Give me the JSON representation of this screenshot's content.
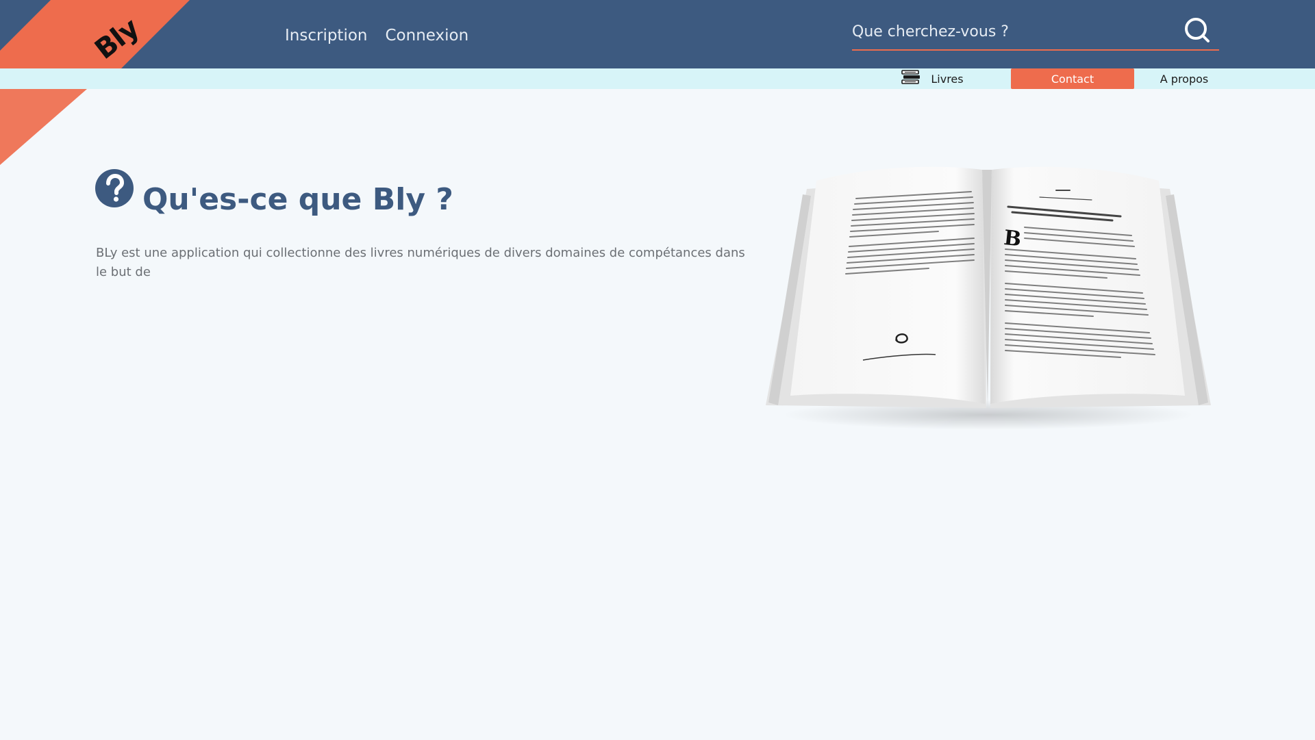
{
  "header": {
    "logo_text": "Bly",
    "nav": {
      "signup_label": "Inscription",
      "login_label": "Connexion"
    },
    "search": {
      "placeholder": "Que cherchez-vous ?",
      "value": "",
      "icon": "search-icon"
    }
  },
  "subnav": {
    "books": {
      "label": "Livres",
      "icon": "books-icon"
    },
    "contact": {
      "label": "Contact"
    },
    "about": {
      "label": "A propos"
    }
  },
  "main": {
    "title_icon": "question-circle-icon",
    "title": "Qu'es-ce que Bly ?",
    "intro": "BLy est une application qui collectionne des livres numériques de divers domaines de compétances dans le but de"
  },
  "colors": {
    "header_bg": "#3d5a80",
    "accent": "#ee6c4d",
    "subnav_bg": "#d7f4f8",
    "page_bg": "#f4f8fb",
    "title": "#3d5a80"
  }
}
